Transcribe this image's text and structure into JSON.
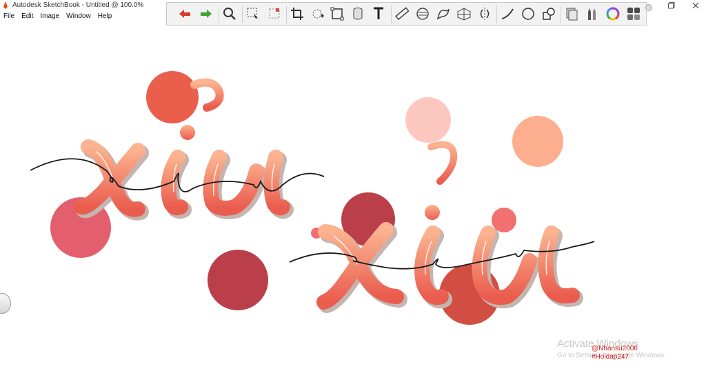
{
  "window": {
    "title": "Autodesk SketchBook - Untitled @ 100.0%"
  },
  "menu": {
    "items": [
      "File",
      "Edit",
      "Image",
      "Window",
      "Help"
    ]
  },
  "toolbar": {
    "tools": [
      "undo-icon",
      "redo-icon",
      "zoom-icon",
      "select-icon",
      "marquee-icon",
      "crop-icon",
      "transform-icon",
      "distort-icon",
      "perspective-icon",
      "text-icon",
      "ruler-icon",
      "ellipse-guide-icon",
      "french-curve-icon",
      "perspective-grid-icon",
      "symmetry-icon",
      "stroke-icon",
      "shape-icon",
      "layers-icon",
      "copic-icon",
      "brush-icon",
      "color-wheel-icon",
      "palette-icon"
    ]
  },
  "canvas": {
    "artwork_text_1": "xiu",
    "artwork_text_2": "xiu",
    "colors": {
      "coral": "#ea5f4c",
      "rose": "#e35f6d",
      "wine": "#bb3f4a",
      "pink": "#fcc7bf",
      "peach": "#fcae8e",
      "salmon": "#f27070",
      "brick": "#d24e42",
      "letter_top": "#fbae8c",
      "letter_bottom": "#eb5a4b",
      "shadow": "#c4b5b1"
    }
  },
  "watermark": {
    "line1": "Activate Windows",
    "line2": "Go to Settings to activate Windows."
  },
  "signature": {
    "line1": "@Nhansu2006",
    "line2": "#Hoidap247"
  }
}
